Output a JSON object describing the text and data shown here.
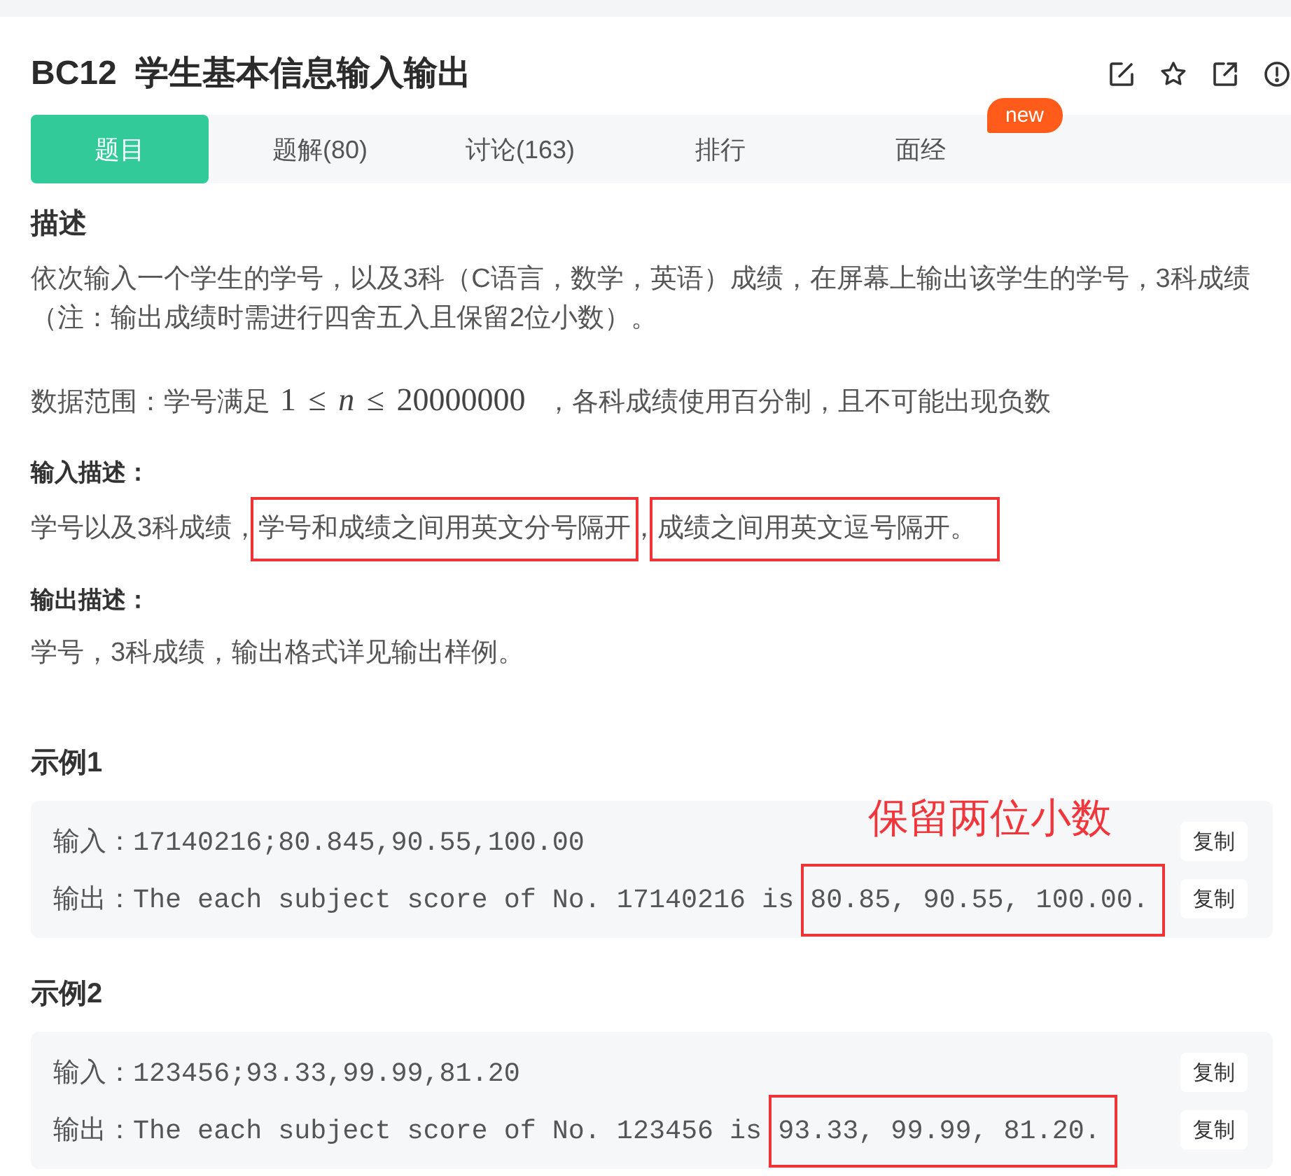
{
  "header": {
    "title": "BC12  学生基本信息输入输出"
  },
  "tabs": [
    {
      "label": "题目",
      "selected": true
    },
    {
      "label": "题解(80)",
      "selected": false
    },
    {
      "label": "讨论(163)",
      "selected": false
    },
    {
      "label": "排行",
      "selected": false
    },
    {
      "label": "面经",
      "selected": false,
      "badge": "new"
    }
  ],
  "description": {
    "heading": "描述",
    "paragraph": "依次输入一个学生的学号，以及3科（C语言，数学，英语）成绩，在屏幕上输出该学生的学号，3科成绩（注：输出成绩时需进行四舍五入且保留2位小数）。",
    "range_note": {
      "prefix": "数据范围：学号满足",
      "formula": "1 ≤ *n* ≤ 20000000",
      "suffix": "，各科成绩使用百分制，且不可能出现负数"
    }
  },
  "input_description": {
    "heading": "输入描述：",
    "segments": [
      {
        "text": "学号以及3科成绩，",
        "highlighted": false
      },
      {
        "text": "学号和成绩之间用英文分号隔开",
        "highlighted": true,
        "after": "，"
      },
      {
        "text": "成绩之间用英文逗号隔开。",
        "highlighted": true
      }
    ]
  },
  "output_description": {
    "heading": "输出描述：",
    "text": "学号，3科成绩，输出格式详见输出样例。"
  },
  "examples": [
    {
      "title": "示例1",
      "annotation": "保留两位小数",
      "lines": [
        {
          "label": "输入：",
          "segments": [
            {
              "text": "17140216;80.845,90.55,100.00",
              "highlighted": false
            }
          ],
          "copy_button": "复制"
        },
        {
          "label": "输出：",
          "segments": [
            {
              "text": "The each subject score of No. 17140216 is ",
              "highlighted": false
            },
            {
              "text": "80.85, 90.55, 100.00.",
              "highlighted": true
            }
          ],
          "copy_button": "复制"
        }
      ]
    },
    {
      "title": "示例2",
      "lines": [
        {
          "label": "输入：",
          "segments": [
            {
              "text": "123456;93.33,99.99,81.20",
              "highlighted": false
            }
          ],
          "copy_button": "复制"
        },
        {
          "label": "输出：",
          "segments": [
            {
              "text": "The each subject score of No. 123456 is ",
              "highlighted": false
            },
            {
              "text": "93.33, 99.99, 81.20.",
              "highlighted": true
            }
          ],
          "copy_button": "复制"
        }
      ]
    }
  ]
}
